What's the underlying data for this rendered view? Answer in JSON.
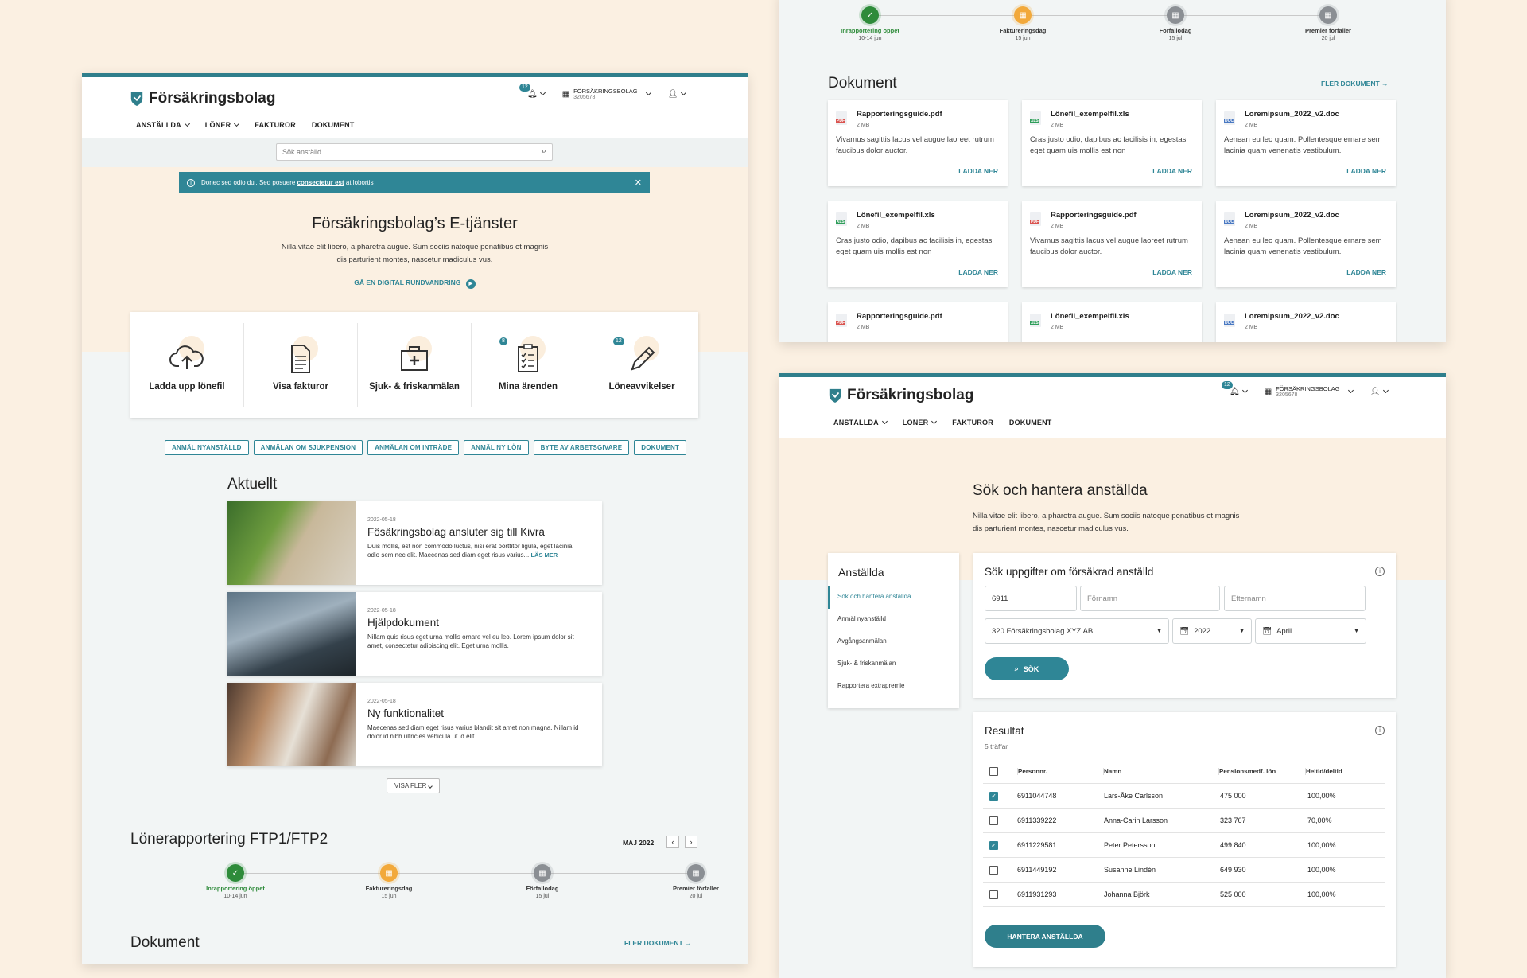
{
  "brand": {
    "name": "Försäkringsbolag",
    "accent": "#2f8696",
    "primary_dark": "#2f7f8c"
  },
  "header": {
    "notif_count": "12",
    "org_name": "FÖRSÄKRINGSBOLAG",
    "org_id": "3205678",
    "nav": [
      "ANSTÄLLDA",
      "LÖNER",
      "FAKTUROR",
      "DOKUMENT"
    ]
  },
  "search": {
    "placeholder": "Sök anställd"
  },
  "alert": {
    "pre": "Donec sed odio dui. Sed posuere ",
    "link": "consectetur est",
    "post": " at lobortis"
  },
  "hero": {
    "title": "Försäkringsbolag’s E-tjänster",
    "text1": "Nilla vitae elit libero, a pharetra augue. Sum sociis natoque penatibus et magnis",
    "text2": "dis parturient montes, nascetur madiculus vus.",
    "link": "GÅ EN DIGITAL RUNDVANDRING"
  },
  "services": [
    {
      "label": "Ladda upp lönefil",
      "icon": "cloud-upload-icon",
      "badge": ""
    },
    {
      "label": "Visa fakturor",
      "icon": "document-icon",
      "badge": ""
    },
    {
      "label": "Sjuk- & friskanmälan",
      "icon": "medical-bag-icon",
      "badge": ""
    },
    {
      "label": "Mina ärenden",
      "icon": "clipboard-icon",
      "badge": "8"
    },
    {
      "label": "Löneavvikelser",
      "icon": "pencil-icon",
      "badge": "12"
    }
  ],
  "quicklinks": [
    "ANMÄL NYANSTÄLLD",
    "ANMÄLAN OM SJUKPENSION",
    "ANMÄLAN OM INTRÄDE",
    "ANMÄL NY LÖN",
    "BYTE AV ARBETSGIVARE",
    "DOKUMENT"
  ],
  "news": {
    "title": "Aktuellt",
    "items": [
      {
        "date": "2022-05-18",
        "title": "Fösäkringsbolag ansluter sig till Kivra",
        "text1": "Duis mollis, est non commodo luctus, nisi erat porttitor ligula, eget lacinia",
        "text2": "odio sem nec elit. Maecenas sed diam eget risus varius...",
        "more": "LÄS MER"
      },
      {
        "date": "2022-05-18",
        "title": "Hjälpdokument",
        "text1": "Nillam quis risus eget urna mollis ornare vel eu leo. Lorem ipsum dolor sit",
        "text2": "amet, consectetur adipiscing elit. Eget urna mollis.",
        "more": ""
      },
      {
        "date": "2022-05-18",
        "title": "Ny funktionalitet",
        "text1": "Maecenas sed diam eget risus varius blandit sit amet non magna. Nillam id",
        "text2": "dolor id nibh ultricies vehicula ut id elit.",
        "more": ""
      }
    ],
    "show_more": "VISA FLER"
  },
  "reporting": {
    "title": "Lönerapportering FTP1/FTP2",
    "month": "MAJ 2022",
    "steps": [
      {
        "name": "Inrapportering öppet",
        "date": "10-14 jun",
        "status": "done"
      },
      {
        "name": "Faktureringsdag",
        "date": "15 jun",
        "status": "current"
      },
      {
        "name": "Förfallodag",
        "date": "15 jul",
        "status": "upcoming"
      },
      {
        "name": "Premier förfaller",
        "date": "20 jul",
        "status": "upcoming"
      }
    ]
  },
  "documents": {
    "title": "Dokument",
    "more": "FLER DOKUMENT",
    "download": "LADDA NER",
    "items": [
      {
        "name": "Rapporteringsguide.pdf",
        "size": "2 MB",
        "type": "PDF",
        "d1": "Vivamus sagittis lacus vel augue laoreet rutrum",
        "d2": "faucibus dolor auctor."
      },
      {
        "name": "Lönefil_exempelfil.xls",
        "size": "2 MB",
        "type": "XLS",
        "d1": "Cras justo odio, dapibus ac facilisis in, egestas",
        "d2": "eget quam uis mollis est non"
      },
      {
        "name": "Loremipsum_2022_v2.doc",
        "size": "2 MB",
        "type": "DOC",
        "d1": "Aenean eu leo quam. Pollentesque ernare sem",
        "d2": "lacinia quam venenatis vestibulum."
      },
      {
        "name": "Lönefil_exempelfil.xls",
        "size": "2 MB",
        "type": "XLS",
        "d1": "Cras justo odio, dapibus ac facilisis in, egestas",
        "d2": "eget quam uis mollis est non"
      },
      {
        "name": "Rapporteringsguide.pdf",
        "size": "2 MB",
        "type": "PDF",
        "d1": "Vivamus sagittis lacus vel augue laoreet rutrum",
        "d2": "faucibus dolor auctor."
      },
      {
        "name": "Loremipsum_2022_v2.doc",
        "size": "2 MB",
        "type": "DOC",
        "d1": "Aenean eu leo quam. Pollentesque ernare sem",
        "d2": "lacinia quam venenatis vestibulum."
      },
      {
        "name": "Rapporteringsguide.pdf",
        "size": "2 MB",
        "type": "PDF",
        "d1": "",
        "d2": ""
      },
      {
        "name": "Lönefil_exempelfil.xls",
        "size": "2 MB",
        "type": "XLS",
        "d1": "",
        "d2": ""
      },
      {
        "name": "Loremipsum_2022_v2.doc",
        "size": "2 MB",
        "type": "DOC",
        "d1": "",
        "d2": ""
      }
    ]
  },
  "employees": {
    "title": "Sök och hantera anställda",
    "text1": "Nilla vitae elit libero, a pharetra augue. Sum sociis natoque penatibus et magnis",
    "text2": "dis parturient montes, nascetur madiculus vus.",
    "side_title": "Anställda",
    "side_items": [
      "Sök och hantera anställda",
      "Anmäl nyanställd",
      "Avgångsanmälan",
      "Sjuk- & friskanmälan",
      "Rapportera extrapremie"
    ],
    "form_title": "Sök uppgifter om försäkrad anställd",
    "pnr_value": "6911",
    "first_ph": "Förnamn",
    "last_ph": "Efternamn",
    "company": "320 Försäkringsbolag XYZ AB",
    "year": "2022",
    "month": "April",
    "search_btn": "SÖK",
    "result_title": "Resultat",
    "hits": "5 träffar",
    "columns": [
      "Personnr.",
      "Namn",
      "Pensionsmedf. lön",
      "Heltid/deltid"
    ],
    "rows": [
      {
        "pnr": "6911044748",
        "name": "Lars-Åke Carlsson",
        "salary": "475 000",
        "pct": "100,00%",
        "checked": true
      },
      {
        "pnr": "6911339222",
        "name": "Anna-Carin Larsson",
        "salary": "323 767",
        "pct": "70,00%",
        "checked": false
      },
      {
        "pnr": "6911229581",
        "name": "Peter Petersson",
        "salary": "499 840",
        "pct": "100,00%",
        "checked": true
      },
      {
        "pnr": "6911449192",
        "name": "Susanne Lindén",
        "salary": "649 930",
        "pct": "100,00%",
        "checked": false
      },
      {
        "pnr": "6911931293",
        "name": "Johanna Björk",
        "salary": "525 000",
        "pct": "100,00%",
        "checked": false
      }
    ],
    "manage_btn": "HANTERA ANSTÄLLDA"
  }
}
